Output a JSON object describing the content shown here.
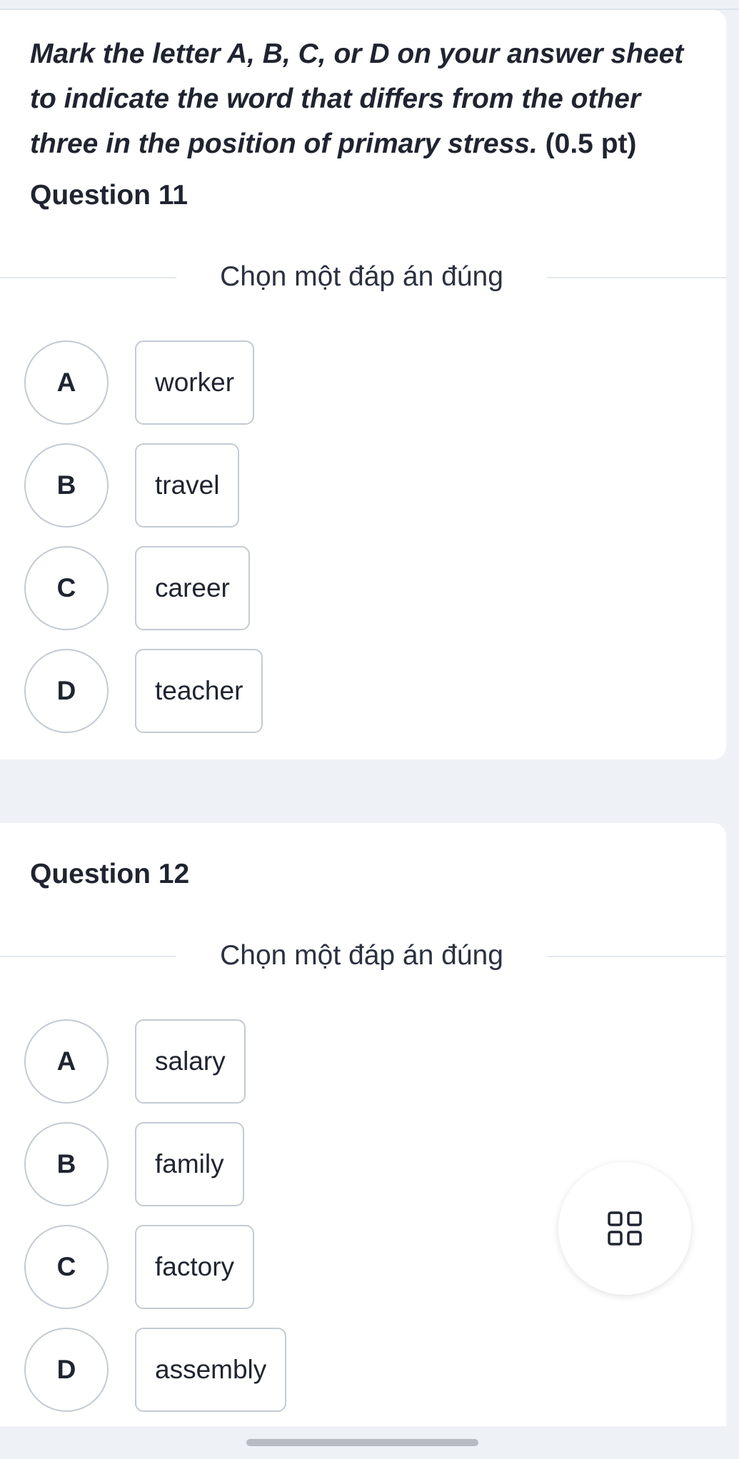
{
  "instruction": {
    "text": "Mark the letter A, B, C, or D on your answer sheet to indicate the word that differs from the other three in the position of primary stress.",
    "points": "(0.5 pt)"
  },
  "questions": [
    {
      "title": "Question 11",
      "prompt": "Chọn một đáp án đúng",
      "options": [
        {
          "letter": "A",
          "text": "worker"
        },
        {
          "letter": "B",
          "text": "travel"
        },
        {
          "letter": "C",
          "text": "career"
        },
        {
          "letter": "D",
          "text": "teacher"
        }
      ]
    },
    {
      "title": "Question 12",
      "prompt": "Chọn một đáp án đúng",
      "options": [
        {
          "letter": "A",
          "text": "salary"
        },
        {
          "letter": "B",
          "text": "family"
        },
        {
          "letter": "C",
          "text": "factory"
        },
        {
          "letter": "D",
          "text": "assembly"
        }
      ]
    }
  ],
  "fab": {
    "icon": "grid-icon"
  },
  "colors": {
    "background": "#eef2f7",
    "card": "#ffffff",
    "border": "#c3cad3",
    "text": "#1f2430"
  }
}
